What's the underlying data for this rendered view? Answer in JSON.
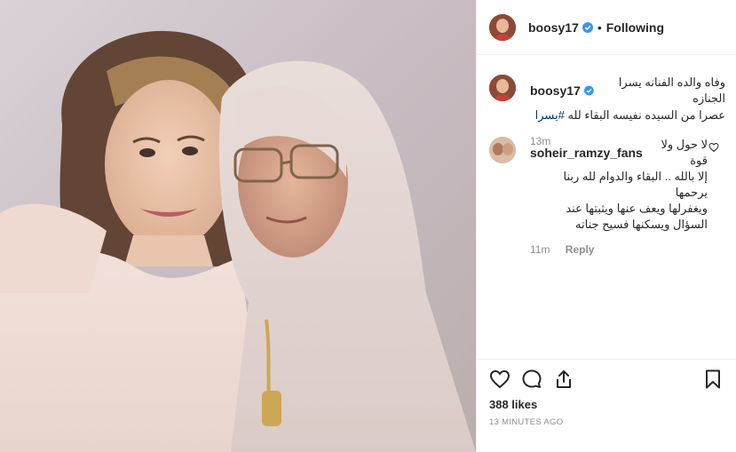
{
  "post": {
    "username": "boosy17",
    "follow_separator": "•",
    "follow_label": "Following"
  },
  "caption": {
    "username": "boosy17",
    "text_line1": "وفاه والده الفنانه يسرا الجنازه",
    "text_line2": "عصرا من السيده نفيسه البقاء لله",
    "hashtag": "#يسرا",
    "time": "13m"
  },
  "comment": {
    "username": "soheir_ramzy_fans",
    "text_line1": "لا حول ولا قوة",
    "text_line2": "إلا بالله .. البقاء والدوام لله ربنا يرحمها",
    "text_line3": "ويغفرلها ويعف عنها ويثبتها عند",
    "text_line4": "السؤال ويسكنها فسيح جناته",
    "time": "11m",
    "reply_label": "Reply"
  },
  "footer": {
    "likes": "388 likes",
    "timestamp": "13 MINUTES AGO"
  },
  "icons": [
    "heart-icon",
    "comment-icon",
    "share-icon",
    "bookmark-icon",
    "verified-badge-icon"
  ],
  "colors": {
    "verified": "#3897f0",
    "muted": "#8e8e8e",
    "text": "#262626"
  }
}
